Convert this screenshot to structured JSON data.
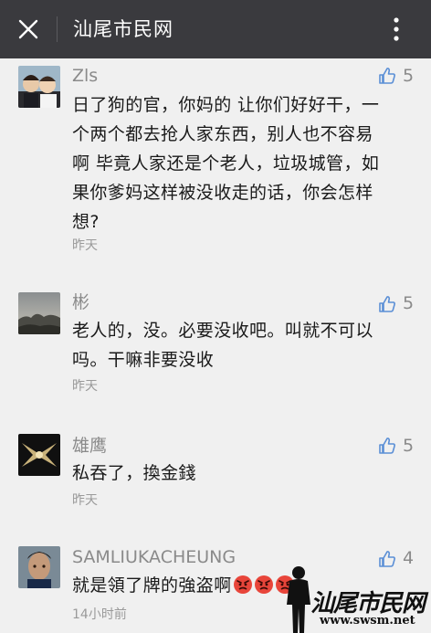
{
  "header": {
    "title": "汕尾市民网",
    "close_icon": "close-icon",
    "menu_icon": "more-vertical-icon",
    "bg_color": "#3a3a3e"
  },
  "comments": [
    {
      "author": "Zls",
      "likes": "5",
      "text_lines": [
        "日了狗的官，你妈的 让你们好好干，一",
        "个两个都去抢人家东西，别人也不容易",
        "啊  毕竟人家还是个老人，垃圾城管，如",
        "果你爹妈这样被没收走的话，你会怎样",
        "想?"
      ],
      "time": "昨天"
    },
    {
      "author": "彬",
      "likes": "5",
      "text_lines": [
        "老人的，没。必要没收吧。叫就不可以",
        "吗。干嘛非要没收"
      ],
      "time": "昨天"
    },
    {
      "author": "雄鹰",
      "likes": "5",
      "text_lines": [
        "私吞了，換金錢"
      ],
      "time": "昨天"
    },
    {
      "author": "SAMLIUKACHEUNG",
      "likes": "4",
      "text_lines": [
        "就是領了牌的強盗啊"
      ],
      "time": "14小时前"
    }
  ],
  "watermark": {
    "text": "汕尾市民网",
    "url": "www.swsm.net"
  },
  "colors": {
    "like_icon": "#5b8fd6",
    "meta_text": "#8a8a8a",
    "page_bg": "#f0f0f0"
  }
}
